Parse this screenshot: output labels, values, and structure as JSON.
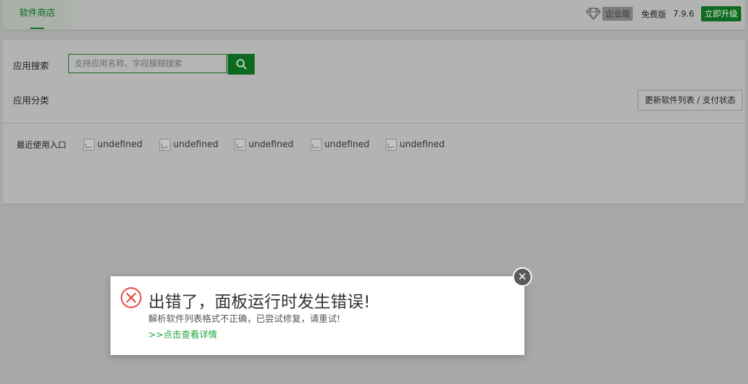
{
  "topbar": {
    "tab_label": "软件商店",
    "enterprise_badge": "企业版",
    "free_label": "免费版",
    "version": "7.9.6",
    "upgrade_label": "立即升级"
  },
  "panel": {
    "search_label": "应用搜索",
    "search_placeholder": "支持应用名称、字段模糊搜索",
    "category_label": "应用分类",
    "refresh_button": "更新软件列表 / 支付状态",
    "recent_label": "最近使用入口",
    "recent_items": [
      "undefined",
      "undefined",
      "undefined",
      "undefined",
      "undefined"
    ]
  },
  "dialog": {
    "title": "出错了，面板运行时发生错误!",
    "message": "解析软件列表格式不正确，已尝试修复，请重试!",
    "link": ">>点击查看详情"
  },
  "colors": {
    "brand_green": "#20a53a",
    "error_red": "#e0443b"
  }
}
